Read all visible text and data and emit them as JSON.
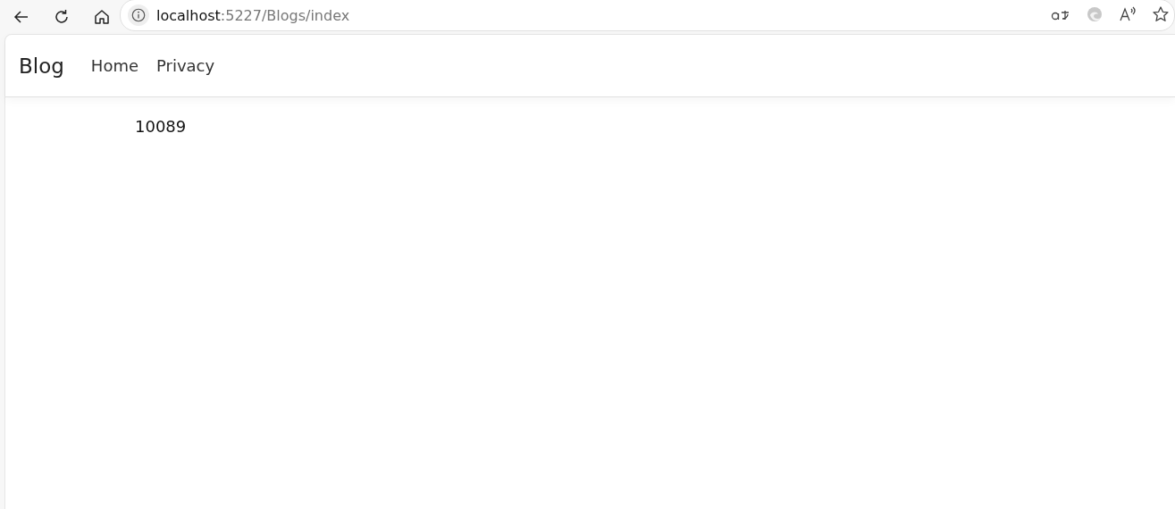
{
  "browser": {
    "url_host": "localhost",
    "url_path": ":5227/Blogs/index"
  },
  "navbar": {
    "brand": "Blog",
    "links": [
      {
        "label": "Home"
      },
      {
        "label": "Privacy"
      }
    ]
  },
  "content": {
    "text": "10089"
  }
}
